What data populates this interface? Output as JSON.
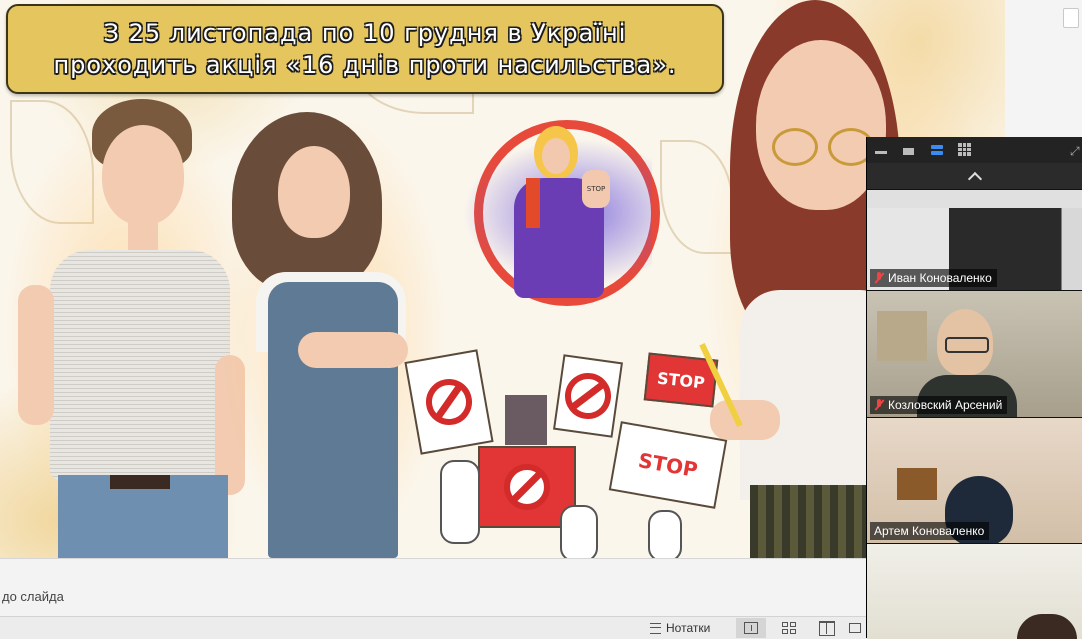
{
  "slide": {
    "title_line1": "З  25 листопада по 10 грудня в Україні",
    "title_line2": "проходить акція «16 днів проти насильства».",
    "signs": [
      "STOP",
      "STOP",
      "STOP"
    ]
  },
  "notes": {
    "placeholder": "до слайда",
    "notes_button_label": "Нотатки"
  },
  "video_panel": {
    "participants": [
      {
        "name": "Иван Коноваленко",
        "muted": true
      },
      {
        "name": "Козловский Арсений",
        "muted": true
      },
      {
        "name": "Артем Коноваленко",
        "muted": false
      },
      {
        "name": "",
        "muted": false
      }
    ]
  },
  "colors": {
    "title_bg": "#e4c55e",
    "accent_red": "#e23636",
    "active_view": "#3a8cf5"
  }
}
